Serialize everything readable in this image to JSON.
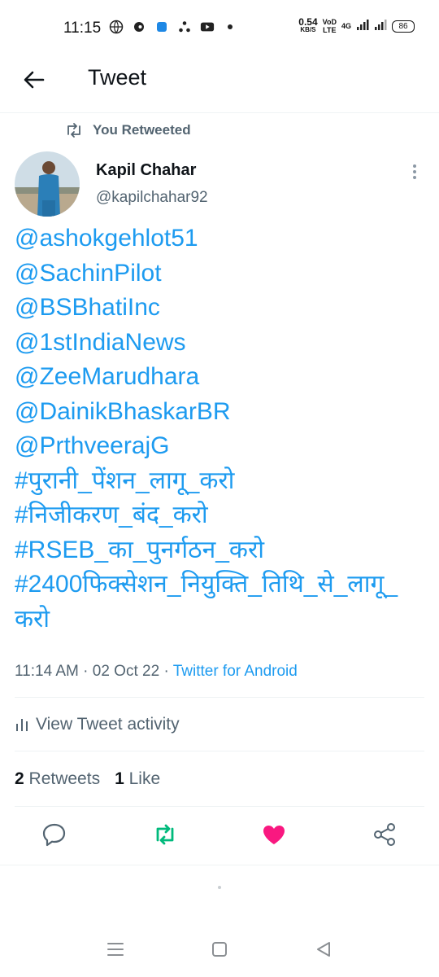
{
  "status_bar": {
    "time": "11:15",
    "net_speed_value": "0.54",
    "net_speed_unit": "KB/S",
    "carrier_line1": "VoD",
    "carrier_line2": "LTE",
    "network": "4G",
    "battery": "86"
  },
  "header": {
    "title": "Tweet"
  },
  "tweet": {
    "retweet_label": "You Retweeted",
    "author_name": "Kapil Chahar",
    "author_handle": "@kapilchahar92",
    "lines": [
      "@ashokgehlot51",
      "@SachinPilot",
      "@BSBhatiInc",
      "@1stIndiaNews",
      "@ZeeMarudhara",
      "@DainikBhaskarBR",
      "@PrthveerajG",
      "#पुरानी_पेंशन_लागू_करो",
      "#निजीकरण_बंद_करो",
      "#RSEB_का_पुनर्गठन_करो",
      "#2400फिक्सेशन_नियुक्ति_तिथि_से_लागू_",
      "करो"
    ],
    "time": "11:14 AM",
    "date": "02 Oct 22",
    "source": "Twitter for Android",
    "activity_label": "View Tweet activity",
    "retweets_count": "2",
    "retweets_label": "Retweets",
    "likes_count": "1",
    "likes_label": "Like"
  },
  "colors": {
    "link": "#1d9bf0",
    "retweet_active": "#00ba7c",
    "like_active": "#f91880",
    "secondary_text": "#536471"
  }
}
